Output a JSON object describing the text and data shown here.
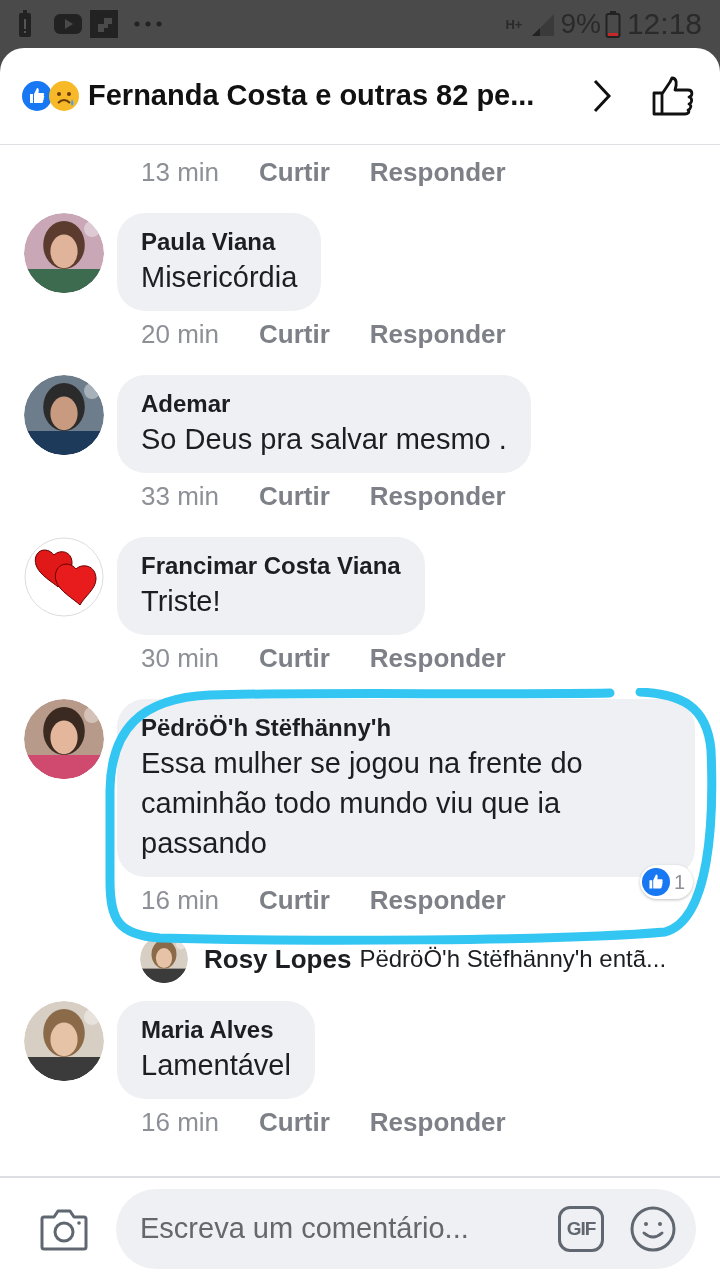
{
  "status_bar": {
    "network": "H+",
    "battery": "9%",
    "time": "12:18"
  },
  "header": {
    "title": "Fernanda Costa e outras 82 pe..."
  },
  "comments": [
    {
      "kind": "partial",
      "time": "13 min",
      "like": "Curtir",
      "reply": "Responder"
    },
    {
      "kind": "comment",
      "name": "Paula Viana",
      "text": "Misericórdia",
      "time": "20 min",
      "like": "Curtir",
      "reply": "Responder"
    },
    {
      "kind": "comment",
      "name": "Ademar",
      "text": "So Deus pra salvar mesmo .",
      "time": "33 min",
      "like": "Curtir",
      "reply": "Responder"
    },
    {
      "kind": "comment",
      "avatar": {
        "kind": "hearts"
      },
      "name": "Francimar Costa Viana",
      "text": "Triste!",
      "time": "30 min",
      "like": "Curtir",
      "reply": "Responder"
    },
    {
      "kind": "comment",
      "name": "PëdröÖ'h Stëfhänny'h",
      "text": "Essa mulher se jogou na frente do caminhão todo mundo viu que ia passando",
      "time": "16 min",
      "like": "Curtir",
      "reply": "Responder",
      "reaction_count": "1",
      "highlighted": true,
      "reply_preview": {
        "name": "Rosy Lopes",
        "text": "PëdröÖ'h Stëfhänny'h entã..."
      }
    },
    {
      "kind": "comment",
      "name": "Maria Alves",
      "text": "Lamentável",
      "time": "16 min",
      "like": "Curtir",
      "reply": "Responder"
    }
  ],
  "composer": {
    "placeholder": "Escreva um comentário...",
    "gif_label": "GIF"
  }
}
